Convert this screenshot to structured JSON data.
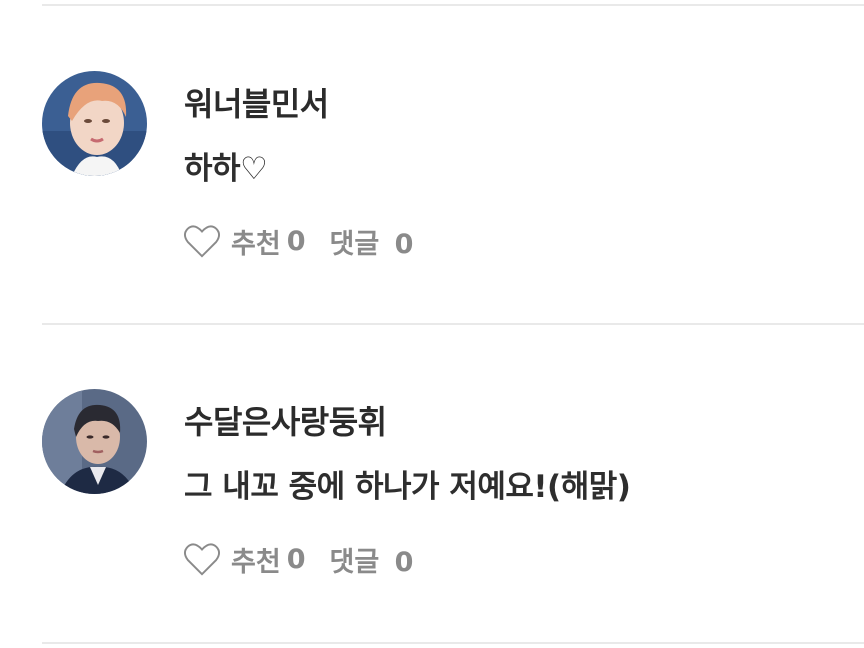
{
  "comments": [
    {
      "username": "워너블민서",
      "text": "하하♡",
      "like_label": "추천",
      "like_count": "0",
      "reply_label": "댓글",
      "reply_count": "0",
      "like_icon": "heart-outline-icon"
    },
    {
      "username": "수달은사랑둥휘",
      "text": "그 내꼬 중에 하나가 저예요!(해맑)",
      "like_label": "추천",
      "like_count": "0",
      "reply_label": "댓글",
      "reply_count": "0",
      "like_icon": "heart-outline-icon"
    }
  ],
  "colors": {
    "divider": "#e9e9e9",
    "text": "#2b2b2b",
    "meta": "#8a8a8a"
  }
}
